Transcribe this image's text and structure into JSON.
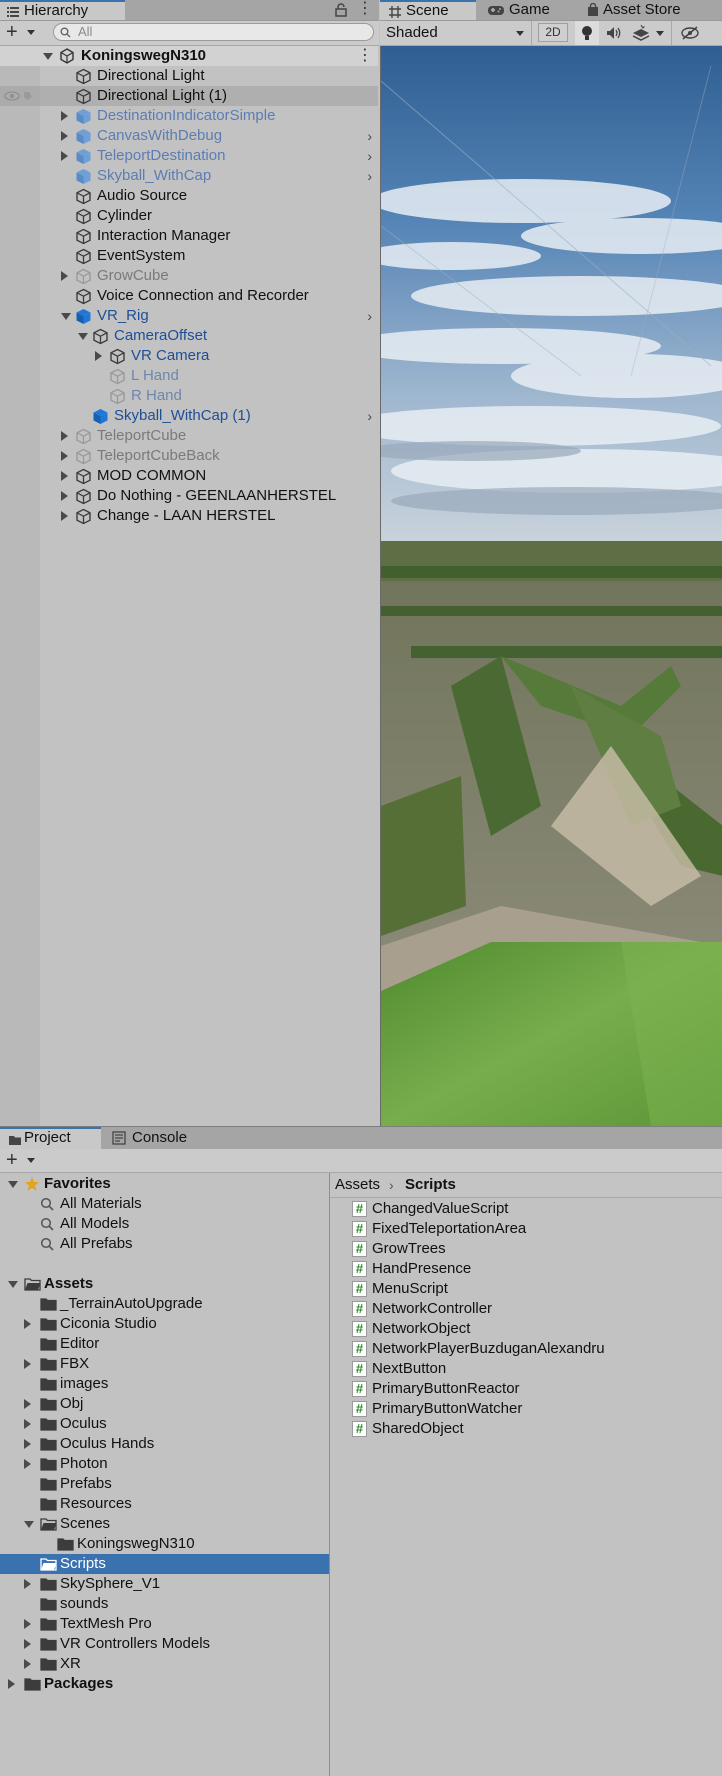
{
  "hierarchy": {
    "tab_label": "Hierarchy",
    "search_placeholder": "All",
    "scene_name": "KoningswegN310",
    "items": [
      {
        "label": "Directional Light"
      },
      {
        "label": "Directional Light (1)"
      },
      {
        "label": "DestinationIndicatorSimple"
      },
      {
        "label": "CanvasWithDebug"
      },
      {
        "label": "TeleportDestination"
      },
      {
        "label": "Skyball_WithCap"
      },
      {
        "label": "Audio Source"
      },
      {
        "label": "Cylinder"
      },
      {
        "label": "Interaction Manager"
      },
      {
        "label": "EventSystem"
      },
      {
        "label": "GrowCube"
      },
      {
        "label": "Voice Connection and Recorder"
      },
      {
        "label": "VR_Rig"
      },
      {
        "label": "CameraOffset"
      },
      {
        "label": "VR Camera"
      },
      {
        "label": "L Hand"
      },
      {
        "label": "R Hand"
      },
      {
        "label": "Skyball_WithCap (1)"
      },
      {
        "label": "TeleportCube"
      },
      {
        "label": "TeleportCubeBack"
      },
      {
        "label": "MOD COMMON"
      },
      {
        "label": "Do Nothing - GEENLAANHERSTEL"
      },
      {
        "label": "Change - LAAN HERSTEL"
      }
    ]
  },
  "scene": {
    "tabs": [
      {
        "label": "Scene"
      },
      {
        "label": "Game"
      },
      {
        "label": "Asset Store"
      }
    ],
    "shading_mode": "Shaded",
    "mode_2d": "2D"
  },
  "project": {
    "tabs": [
      {
        "label": "Project"
      },
      {
        "label": "Console"
      }
    ],
    "favorites": {
      "label": "Favorites",
      "items": [
        {
          "label": "All Materials"
        },
        {
          "label": "All Models"
        },
        {
          "label": "All Prefabs"
        }
      ]
    },
    "assets_label": "Assets",
    "folders": [
      {
        "label": "_TerrainAutoUpgrade"
      },
      {
        "label": "Ciconia Studio"
      },
      {
        "label": "Editor"
      },
      {
        "label": "FBX"
      },
      {
        "label": "images"
      },
      {
        "label": "Obj"
      },
      {
        "label": "Oculus"
      },
      {
        "label": "Oculus Hands"
      },
      {
        "label": "Photon"
      },
      {
        "label": "Prefabs"
      },
      {
        "label": "Resources"
      },
      {
        "label": "Scenes"
      },
      {
        "label": "KoningswegN310"
      },
      {
        "label": "Scripts"
      },
      {
        "label": "SkySphere_V1"
      },
      {
        "label": "sounds"
      },
      {
        "label": "TextMesh Pro"
      },
      {
        "label": "VR Controllers Models"
      },
      {
        "label": "XR"
      }
    ],
    "packages_label": "Packages",
    "breadcrumb": {
      "root": "Assets",
      "current": "Scripts"
    },
    "scripts": [
      {
        "label": "ChangedValueScript"
      },
      {
        "label": "FixedTeleportationArea"
      },
      {
        "label": "GrowTrees"
      },
      {
        "label": "HandPresence"
      },
      {
        "label": "MenuScript"
      },
      {
        "label": "NetworkController"
      },
      {
        "label": "NetworkObject"
      },
      {
        "label": "NetworkPlayerBuzduganAlexandru"
      },
      {
        "label": "NextButton"
      },
      {
        "label": "PrimaryButtonReactor"
      },
      {
        "label": "PrimaryButtonWatcher"
      },
      {
        "label": "SharedObject"
      }
    ]
  }
}
